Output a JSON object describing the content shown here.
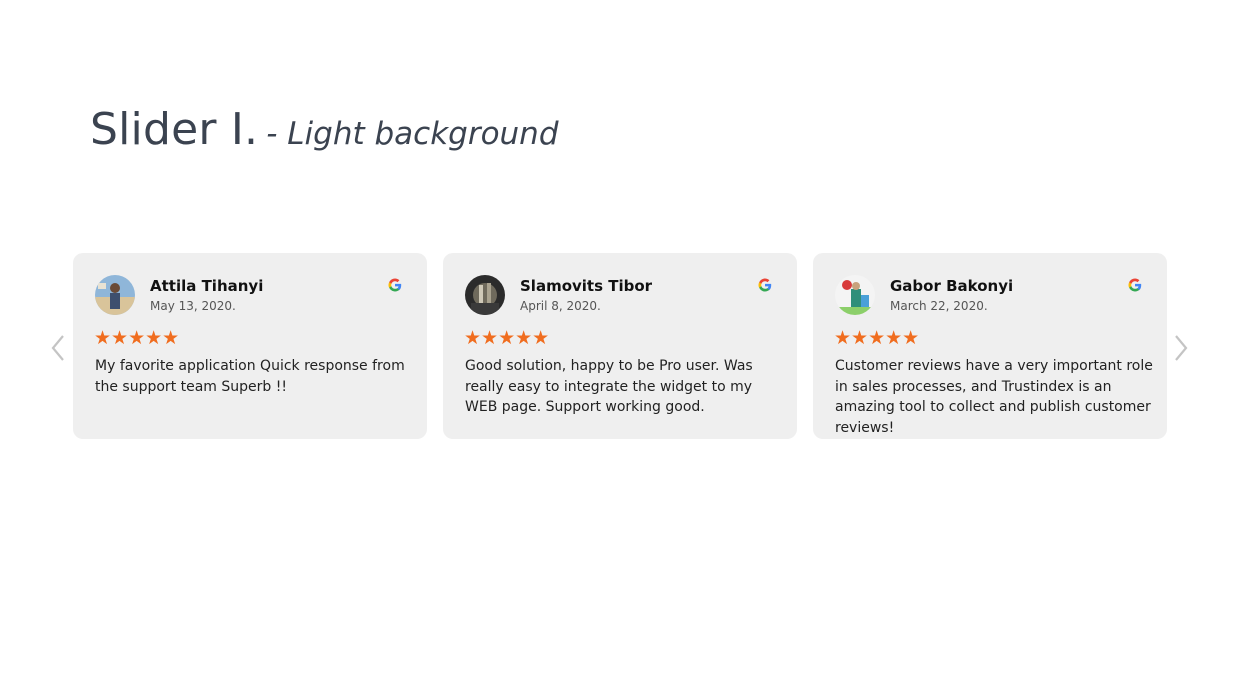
{
  "heading": {
    "title": "Slider I.",
    "subtitle": "- Light background"
  },
  "colors": {
    "star": "#f06d1f",
    "card_bg": "#efefef",
    "heading": "#3b4350"
  },
  "reviews": [
    {
      "name": "Attila Tihanyi",
      "date": "May 13, 2020.",
      "stars": "★★★★★",
      "rating": 5,
      "text": "My favorite application Quick response from the support team Superb !!",
      "source_icon": "google-icon"
    },
    {
      "name": "Slamovits Tibor",
      "date": "April 8, 2020.",
      "stars": "★★★★★",
      "rating": 5,
      "text": "Good solution, happy to be Pro user. Was really easy to integrate the widget to my WEB page. Support working good.",
      "source_icon": "google-icon"
    },
    {
      "name": "Gabor Bakonyi",
      "date": "March 22, 2020.",
      "stars": "★★★★★",
      "rating": 5,
      "text": "Customer reviews have a very important role in sales processes, and Trustindex is an amazing tool to collect and publish customer reviews!",
      "source_icon": "google-icon"
    }
  ],
  "nav": {
    "prev_icon": "chevron-left-icon",
    "next_icon": "chevron-right-icon"
  }
}
